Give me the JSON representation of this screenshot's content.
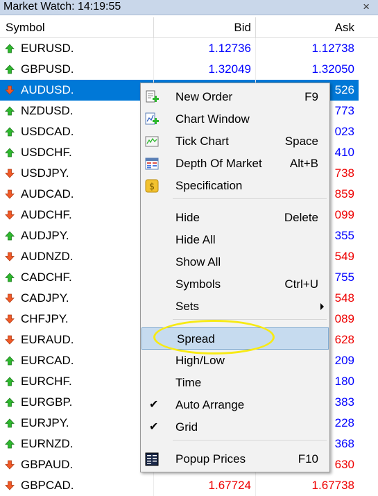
{
  "window": {
    "title": "Market Watch: 14:19:55",
    "close_glyph": "×"
  },
  "columns": {
    "symbol": "Symbol",
    "bid": "Bid",
    "ask": "Ask"
  },
  "rows": [
    {
      "symbol": "EURUSD.",
      "dir": "up",
      "bid": "1.12736",
      "ask": "1.12738"
    },
    {
      "symbol": "GBPUSD.",
      "dir": "up",
      "bid": "1.32049",
      "ask": "1.32050"
    },
    {
      "symbol": "AUDUSD.",
      "dir": "down",
      "bid": "",
      "ask": "526",
      "selected": true
    },
    {
      "symbol": "NZDUSD.",
      "dir": "up",
      "bid": "",
      "ask": "773"
    },
    {
      "symbol": "USDCAD.",
      "dir": "up",
      "bid": "",
      "ask": "023"
    },
    {
      "symbol": "USDCHF.",
      "dir": "up",
      "bid": "",
      "ask": "410"
    },
    {
      "symbol": "USDJPY.",
      "dir": "down",
      "bid": "",
      "ask": "738"
    },
    {
      "symbol": "AUDCAD.",
      "dir": "down",
      "bid": "",
      "ask": "859"
    },
    {
      "symbol": "AUDCHF.",
      "dir": "down",
      "bid": "",
      "ask": "099"
    },
    {
      "symbol": "AUDJPY.",
      "dir": "up",
      "bid": "",
      "ask": "355"
    },
    {
      "symbol": "AUDNZD.",
      "dir": "down",
      "bid": "",
      "ask": "549"
    },
    {
      "symbol": "CADCHF.",
      "dir": "up",
      "bid": "",
      "ask": "755"
    },
    {
      "symbol": "CADJPY.",
      "dir": "down",
      "bid": "",
      "ask": "548"
    },
    {
      "symbol": "CHFJPY.",
      "dir": "down",
      "bid": "",
      "ask": "089"
    },
    {
      "symbol": "EURAUD.",
      "dir": "down",
      "bid": "",
      "ask": "628"
    },
    {
      "symbol": "EURCAD.",
      "dir": "up",
      "bid": "",
      "ask": "209"
    },
    {
      "symbol": "EURCHF.",
      "dir": "up",
      "bid": "",
      "ask": "180"
    },
    {
      "symbol": "EURGBP.",
      "dir": "up",
      "bid": "",
      "ask": "383"
    },
    {
      "symbol": "EURJPY.",
      "dir": "up",
      "bid": "",
      "ask": "228"
    },
    {
      "symbol": "EURNZD.",
      "dir": "up",
      "bid": "",
      "ask": "368"
    },
    {
      "symbol": "GBPAUD.",
      "dir": "down",
      "bid": "",
      "ask": "630"
    },
    {
      "symbol": "GBPCAD.",
      "dir": "down",
      "bid": "1.67724",
      "ask": "1.67738"
    }
  ],
  "menu": {
    "items": [
      {
        "name": "new-order",
        "label": "New Order",
        "shortcut": "F9",
        "icon": "new-order-icon"
      },
      {
        "name": "chart-window",
        "label": "Chart Window",
        "shortcut": "",
        "icon": "chart-window-icon"
      },
      {
        "name": "tick-chart",
        "label": "Tick Chart",
        "shortcut": "Space",
        "icon": "tick-chart-icon"
      },
      {
        "name": "depth-of-market",
        "label": "Depth Of Market",
        "shortcut": "Alt+B",
        "icon": "depth-of-market-icon"
      },
      {
        "name": "specification",
        "label": "Specification",
        "shortcut": "",
        "icon": "specification-icon"
      },
      {
        "name": "hide",
        "label": "Hide",
        "shortcut": "Delete"
      },
      {
        "name": "hide-all",
        "label": "Hide All",
        "shortcut": ""
      },
      {
        "name": "show-all",
        "label": "Show All",
        "shortcut": ""
      },
      {
        "name": "symbols",
        "label": "Symbols",
        "shortcut": "Ctrl+U"
      },
      {
        "name": "sets",
        "label": "Sets",
        "shortcut": "",
        "submenu": true
      },
      {
        "name": "spread",
        "label": "Spread",
        "shortcut": "",
        "highlighted": true
      },
      {
        "name": "high-low",
        "label": "High/Low",
        "shortcut": ""
      },
      {
        "name": "time",
        "label": "Time",
        "shortcut": ""
      },
      {
        "name": "auto-arrange",
        "label": "Auto Arrange",
        "shortcut": "",
        "checked": true
      },
      {
        "name": "grid",
        "label": "Grid",
        "shortcut": "",
        "checked": true
      },
      {
        "name": "popup-prices",
        "label": "Popup Prices",
        "shortcut": "F10",
        "icon": "popup-prices-icon"
      }
    ],
    "check_glyph": "✔"
  },
  "colors": {
    "up": "#0000ff",
    "down": "#ee0000",
    "selection": "#0078d7",
    "highlight_ring": "#f7ea14"
  }
}
